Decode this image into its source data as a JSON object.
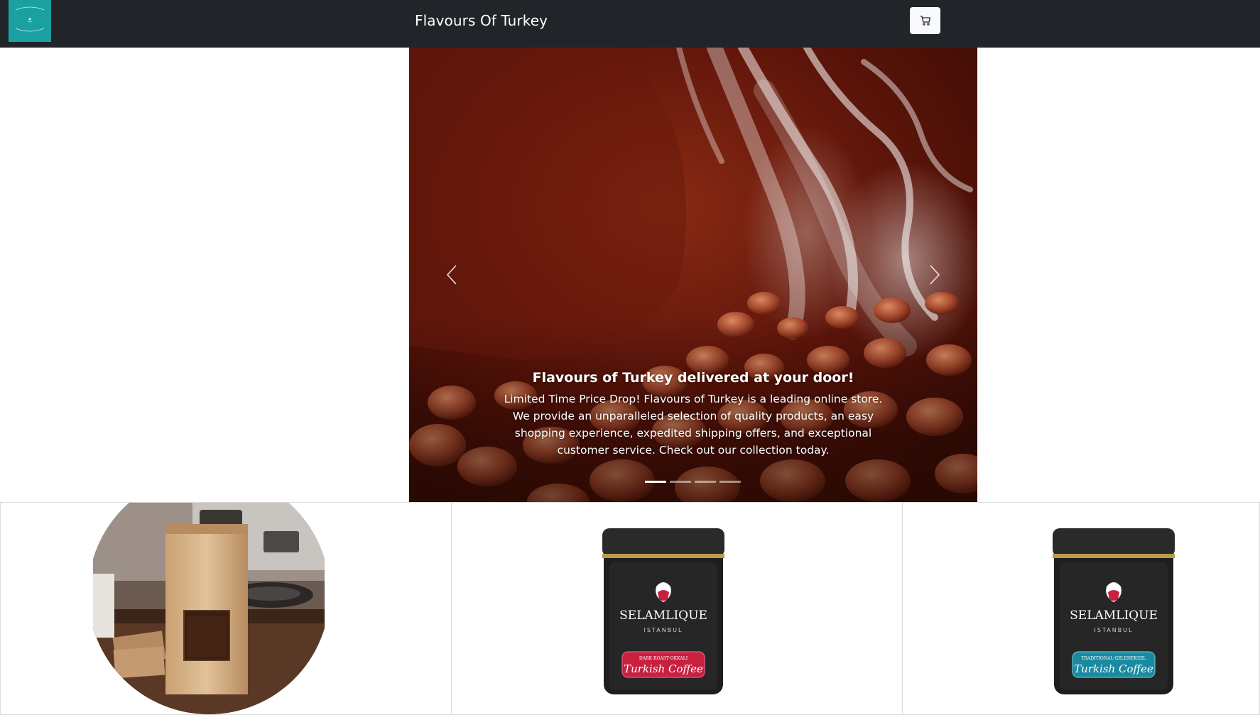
{
  "navbar": {
    "brand": "Flavours Of Turkey",
    "logo_icon": "flavours-of-turkey-logo",
    "cart_icon": "cart-icon",
    "colors": {
      "background": "#212529",
      "logo_bg": "#1aa0a0"
    }
  },
  "carousel": {
    "slide_count": 4,
    "active_index": 0,
    "caption_title": "Flavours of Turkey delivered at your door!",
    "caption_text": "Limited Time Price Drop! Flavours of Turkey is a leading online store. We provide an unparalleled selection of quality products, an easy shopping experience, expedited shipping offers, and exceptional customer service. Check out our collection today.",
    "prev_icon": "chevron-left-icon",
    "next_icon": "chevron-right-icon"
  },
  "products": [
    {
      "image": "coffee-bag-image"
    },
    {
      "image": "selamlique-dark-roast-tin-image",
      "brand": "SELAMLIQUE",
      "city": "ISTANBUL",
      "variant": "DARK ROAST·OKKALI",
      "product": "Turkish Coffee",
      "label_color": "#c8203f"
    },
    {
      "image": "selamlique-traditional-tin-image",
      "brand": "SELAMLIQUE",
      "city": "ISTANBUL",
      "variant": "TRADITIONAL·GELENEKSEL",
      "product": "Turkish Coffee",
      "label_color": "#1a8aa0"
    }
  ]
}
